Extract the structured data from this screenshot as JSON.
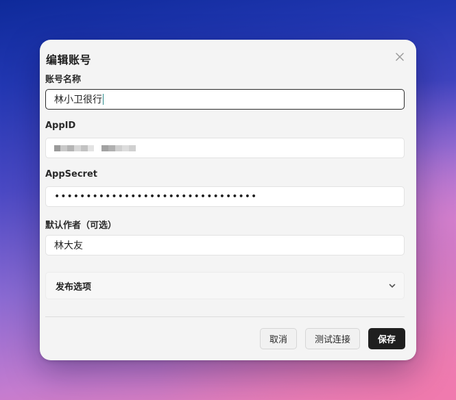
{
  "dialog": {
    "title": "编辑账号",
    "close_icon": "close-icon"
  },
  "fields": {
    "account_name": {
      "label": "账号名称",
      "value": "林小卫很行"
    },
    "app_id": {
      "label": "AppID",
      "value_redacted": true
    },
    "app_secret": {
      "label": "AppSecret",
      "value": "••••••••••••••••••••••••••••••••"
    },
    "default_author": {
      "label": "默认作者（可选）",
      "value": "林大友"
    }
  },
  "publish_options": {
    "label": "发布选项",
    "icon": "chevron-down-icon",
    "expanded": false
  },
  "buttons": {
    "cancel": "取消",
    "test_connection": "测试连接",
    "save": "保存"
  },
  "colors": {
    "primary_button": "#1f1f1f",
    "dialog_bg": "#f4f4f4"
  }
}
